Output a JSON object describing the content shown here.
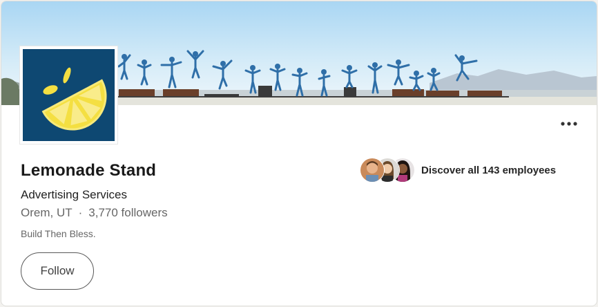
{
  "company": {
    "name": "Lemonade Stand",
    "industry": "Advertising Services",
    "location": "Orem, UT",
    "separator": "·",
    "followers": "3,770 followers",
    "tagline": "Build Then Bless."
  },
  "actions": {
    "follow_label": "Follow",
    "more_icon": "more-horizontal-icon"
  },
  "employees": {
    "label": "Discover all 143 employees",
    "avatar_count": 3
  },
  "colors": {
    "logo_background": "#0e4872",
    "lemon_yellow": "#f4df42",
    "lemon_light": "#f9ec8a",
    "sky_top": "#b7dff6",
    "sky_bottom": "#e8f4fb"
  }
}
